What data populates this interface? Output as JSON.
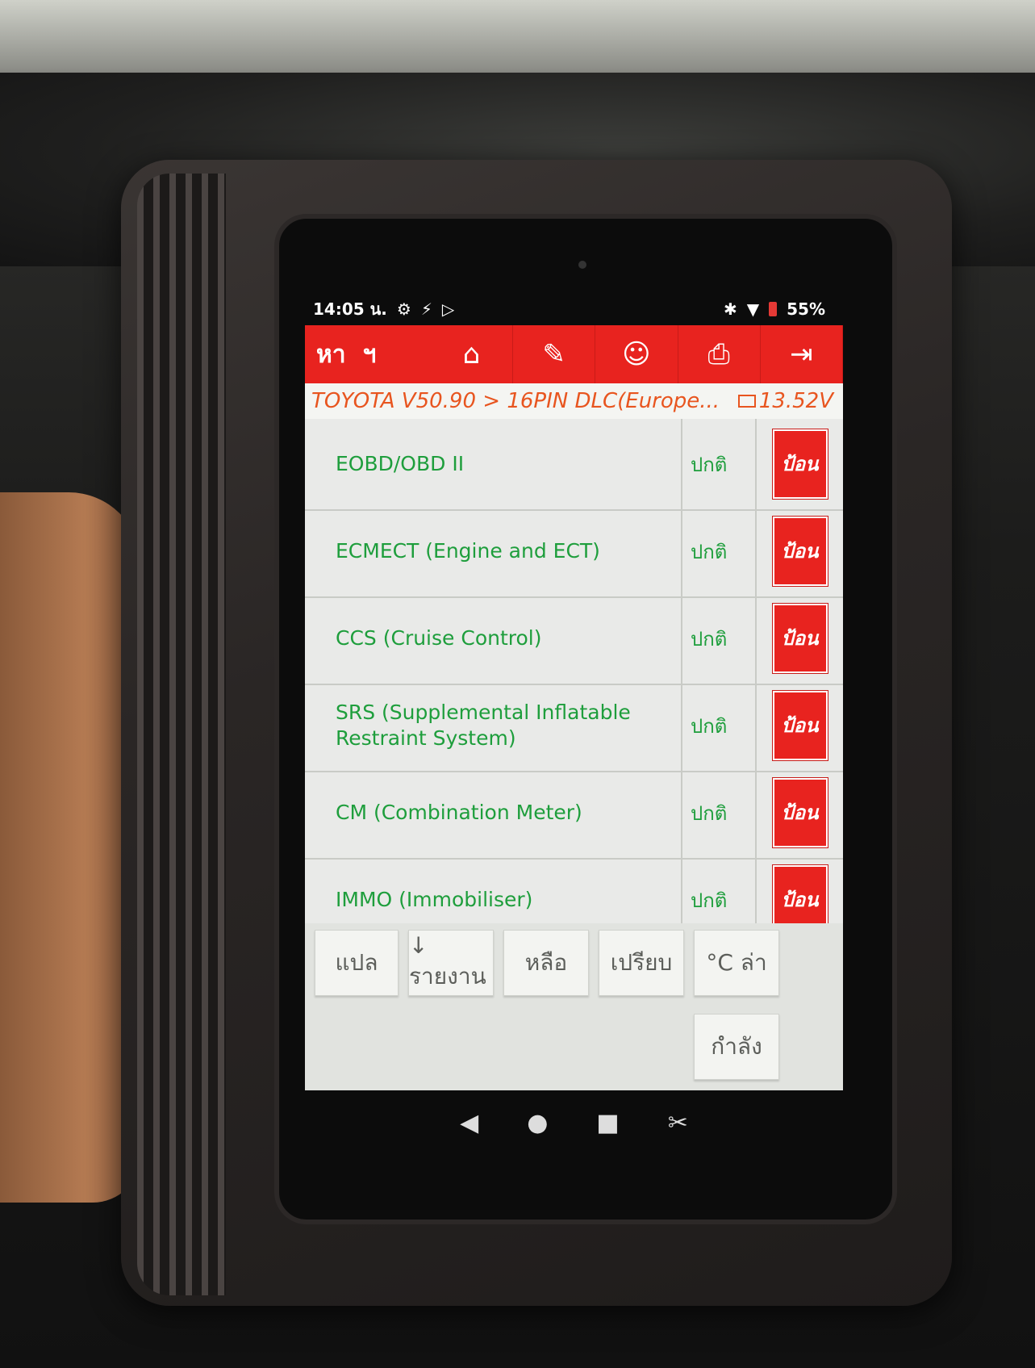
{
  "statusbar": {
    "time": "14:05 น.",
    "icons_left": [
      "gear-icon",
      "usb-icon",
      "play-store-icon"
    ],
    "battery": "55%"
  },
  "toolbar": {
    "title": "หา",
    "mark": "ฯ",
    "icons": [
      "home-icon",
      "edit-icon",
      "user-icon",
      "print-icon",
      "exit-icon"
    ]
  },
  "breadcrumb": {
    "path": "TOYOTA V50.90 > 16PIN DLC(Europe...",
    "voltage": "13.52V"
  },
  "systems": [
    {
      "name": "EOBD/OBD II",
      "status": "ปกติ",
      "action": "ป้อน"
    },
    {
      "name": "ECMECT (Engine and ECT)",
      "status": "ปกติ",
      "action": "ป้อน"
    },
    {
      "name": "CCS (Cruise Control)",
      "status": "ปกติ",
      "action": "ป้อน"
    },
    {
      "name": "SRS (Supplemental Inflatable Restraint System)",
      "status": "ปกติ",
      "action": "ป้อน"
    },
    {
      "name": "CM (Combination Meter)",
      "status": "ปกติ",
      "action": "ป้อน"
    },
    {
      "name": "IMMO (Immobiliser)",
      "status": "ปกติ",
      "action": "ป้อน"
    }
  ],
  "bottom_buttons": {
    "b1": "แปล",
    "b2": "↓ รายงาน",
    "b3": "หลือ",
    "b4": "เปรียบ",
    "b5": "°C ล่า",
    "b6": "กำลัง"
  },
  "colors": {
    "accent": "#e8231f",
    "text_green": "#1e9e3c",
    "breadcrumb": "#e8551f"
  }
}
